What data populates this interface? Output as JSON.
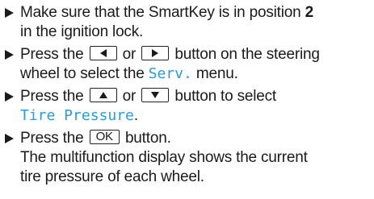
{
  "steps": [
    {
      "text_a": "Make sure that the SmartKey is in position ",
      "bold": "2",
      "text_b": "in the ignition lock."
    },
    {
      "text_a": "Press the",
      "key1_icon": "triangle-left-icon",
      "or": "or",
      "key2_icon": "triangle-right-icon",
      "text_b": "button on the steering",
      "text_c": "wheel to select the ",
      "display": "Serv.",
      "text_d": " menu."
    },
    {
      "text_a": "Press the",
      "key1_icon": "triangle-up-icon",
      "or": "or",
      "key2_icon": "triangle-down-icon",
      "text_b": "button to select",
      "display": "Tire Pressure",
      "text_c": "."
    },
    {
      "text_a": "Press the",
      "key_label": "OK",
      "text_b": "button.",
      "text_c": "The multifunction display shows the current",
      "text_d": "tire pressure of each wheel."
    }
  ]
}
